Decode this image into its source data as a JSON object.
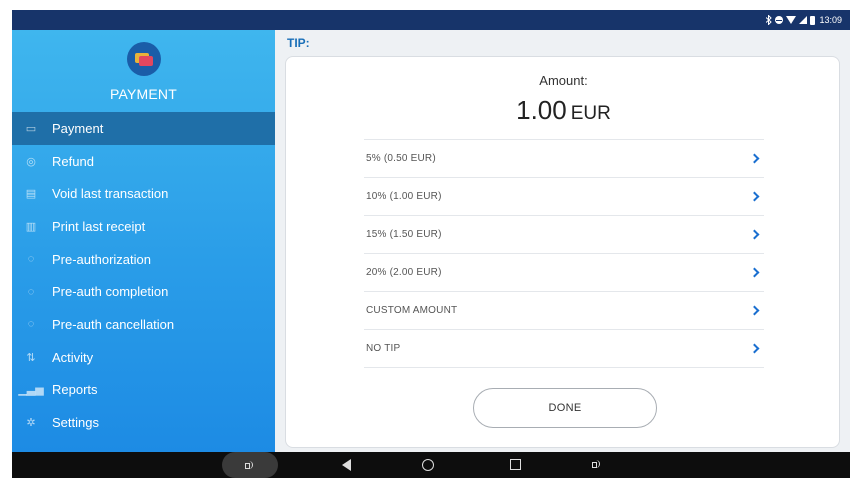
{
  "status_bar": {
    "time": "13:09",
    "icons": [
      "bluetooth-icon",
      "do-not-disturb-icon",
      "wifi-icon",
      "signal-icon",
      "battery-icon"
    ]
  },
  "sidebar": {
    "title": "PAYMENT",
    "logo_icon": "card-stack-icon",
    "items": [
      {
        "label": "Payment",
        "icon": "payment-icon",
        "active": true
      },
      {
        "label": "Refund",
        "icon": "refund-icon",
        "active": false
      },
      {
        "label": "Void last transaction",
        "icon": "void-icon",
        "active": false
      },
      {
        "label": "Print last receipt",
        "icon": "receipt-icon",
        "active": false
      },
      {
        "label": "Pre-authorization",
        "icon": "preauth-icon",
        "active": false
      },
      {
        "label": "Pre-auth completion",
        "icon": "preauth-completion-icon",
        "active": false
      },
      {
        "label": "Pre-auth cancellation",
        "icon": "preauth-cancel-icon",
        "active": false
      },
      {
        "label": "Activity",
        "icon": "activity-icon",
        "active": false
      },
      {
        "label": "Reports",
        "icon": "reports-icon",
        "active": false
      },
      {
        "label": "Settings",
        "icon": "settings-icon",
        "active": false
      }
    ]
  },
  "main": {
    "section_label": "TIP:",
    "amount_label": "Amount:",
    "amount_value": "1.00",
    "amount_currency": "EUR",
    "options": [
      {
        "label": "5% (0.50 EUR)"
      },
      {
        "label": "10% (1.00 EUR)"
      },
      {
        "label": "15% (1.50 EUR)"
      },
      {
        "label": "20% (2.00 EUR)"
      },
      {
        "label": "CUSTOM AMOUNT"
      },
      {
        "label": "NO TIP"
      }
    ],
    "done_label": "DONE"
  },
  "colors": {
    "accent": "#1a6fd0",
    "sidebar_top": "#3fb6ee",
    "sidebar_bottom": "#1d8be4",
    "sidebar_active": "#1f6fa8",
    "status_bar": "#17346a"
  }
}
